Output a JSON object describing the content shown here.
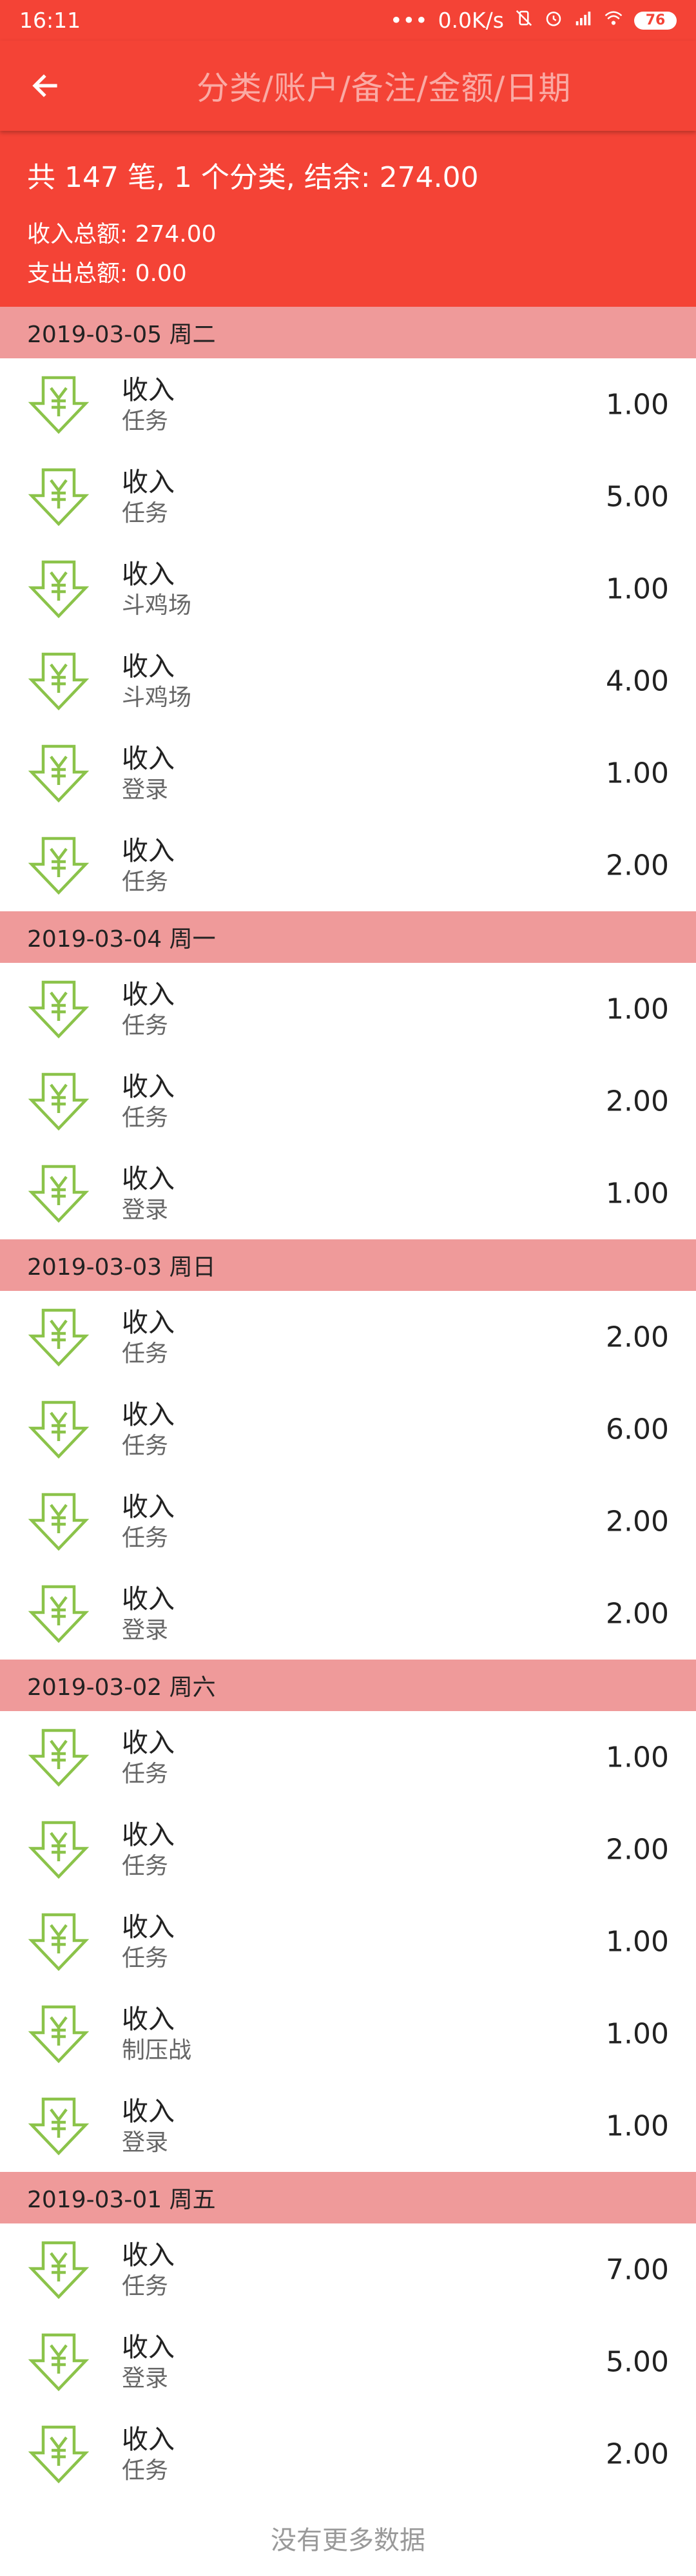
{
  "status_bar": {
    "time": "16:11",
    "dots": "•••",
    "speed": "0.0K/s",
    "battery": "76",
    "icons": [
      "vibrate-off-icon",
      "alarm-icon",
      "signal-icon",
      "wifi-icon"
    ]
  },
  "app_bar": {
    "back_icon": "arrow-left-icon",
    "search_placeholder": "分类/账户/备注/金额/日期"
  },
  "summary": {
    "line1": "共 147 笔, 1 个分类, 结余: 274.00",
    "income": "收入总额: 274.00",
    "expense": "支出总额: 0.00"
  },
  "colors": {
    "primary": "#f44336",
    "header": "#ef9a9a",
    "icon": "#8bc34a"
  },
  "groups": [
    {
      "date": "2019-03-05 周二",
      "items": [
        {
          "title": "收入",
          "sub": "任务",
          "amount": "1.00"
        },
        {
          "title": "收入",
          "sub": "任务",
          "amount": "5.00"
        },
        {
          "title": "收入",
          "sub": "斗鸡场",
          "amount": "1.00"
        },
        {
          "title": "收入",
          "sub": "斗鸡场",
          "amount": "4.00"
        },
        {
          "title": "收入",
          "sub": "登录",
          "amount": "1.00"
        },
        {
          "title": "收入",
          "sub": "任务",
          "amount": "2.00"
        }
      ]
    },
    {
      "date": "2019-03-04 周一",
      "items": [
        {
          "title": "收入",
          "sub": "任务",
          "amount": "1.00"
        },
        {
          "title": "收入",
          "sub": "任务",
          "amount": "2.00"
        },
        {
          "title": "收入",
          "sub": "登录",
          "amount": "1.00"
        }
      ]
    },
    {
      "date": "2019-03-03 周日",
      "items": [
        {
          "title": "收入",
          "sub": "任务",
          "amount": "2.00"
        },
        {
          "title": "收入",
          "sub": "任务",
          "amount": "6.00"
        },
        {
          "title": "收入",
          "sub": "任务",
          "amount": "2.00"
        },
        {
          "title": "收入",
          "sub": "登录",
          "amount": "2.00"
        }
      ]
    },
    {
      "date": "2019-03-02 周六",
      "items": [
        {
          "title": "收入",
          "sub": "任务",
          "amount": "1.00"
        },
        {
          "title": "收入",
          "sub": "任务",
          "amount": "2.00"
        },
        {
          "title": "收入",
          "sub": "任务",
          "amount": "1.00"
        },
        {
          "title": "收入",
          "sub": "制压战",
          "amount": "1.00"
        },
        {
          "title": "收入",
          "sub": "登录",
          "amount": "1.00"
        }
      ]
    },
    {
      "date": "2019-03-01 周五",
      "items": [
        {
          "title": "收入",
          "sub": "任务",
          "amount": "7.00"
        },
        {
          "title": "收入",
          "sub": "登录",
          "amount": "5.00"
        },
        {
          "title": "收入",
          "sub": "任务",
          "amount": "2.00"
        }
      ]
    }
  ],
  "footer": {
    "no_more": "没有更多数据"
  }
}
